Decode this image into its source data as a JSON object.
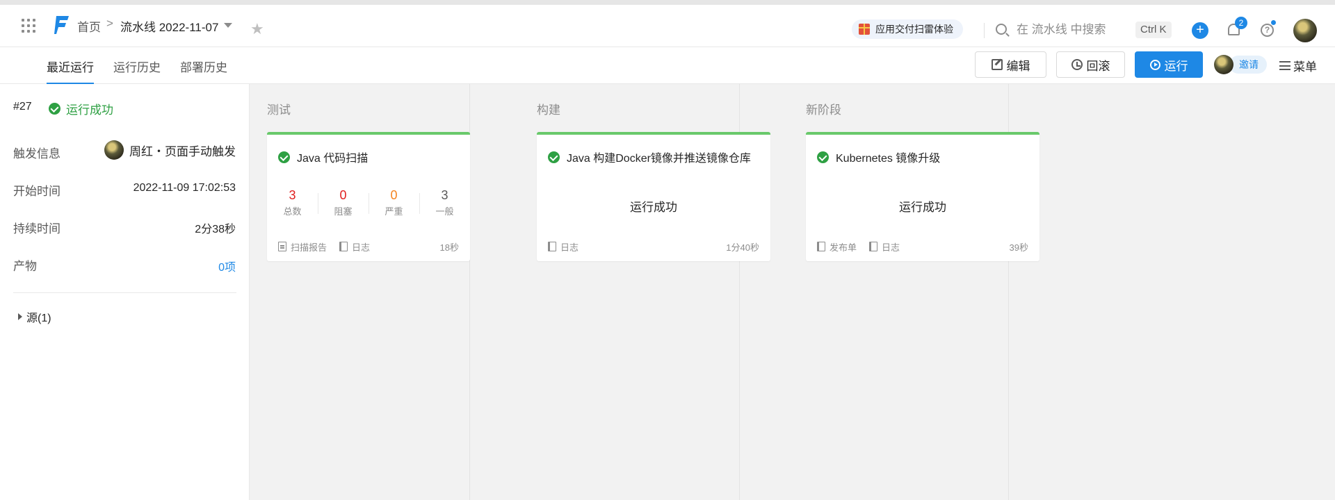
{
  "header": {
    "breadcrumb_home": "首页",
    "breadcrumb_sep": ">",
    "pipeline_name": "流水线 2022-11-07",
    "promo_label": "应用交付扫雷体验",
    "search_placeholder": "在 流水线 中搜索",
    "search_shortcut": "Ctrl K",
    "add_label": "+",
    "notification_count": "2",
    "help_label": "?"
  },
  "subnav": {
    "tabs": [
      {
        "label": "最近运行",
        "active": true
      },
      {
        "label": "运行历史",
        "active": false
      },
      {
        "label": "部署历史",
        "active": false
      }
    ],
    "edit_label": "编辑",
    "rollback_label": "回滚",
    "run_label": "运行",
    "invite_label": "邀请",
    "menu_label": "菜单"
  },
  "run": {
    "number": "#27",
    "status": "运行成功",
    "trigger_label": "触发信息",
    "trigger_value": "周红・页面手动触发",
    "start_label": "开始时间",
    "start_value": "2022-11-09 17:02:53",
    "duration_label": "持续时间",
    "duration_value": "2分38秒",
    "artifact_label": "产物",
    "artifact_value": "0项",
    "source_label": "源(1)"
  },
  "stages": [
    {
      "title": "测试",
      "job": {
        "name": "Java 代码扫描",
        "metrics": [
          {
            "value": "3",
            "label": "总数",
            "color": "#e02020"
          },
          {
            "value": "0",
            "label": "阻塞",
            "color": "#e02020"
          },
          {
            "value": "0",
            "label": "严重",
            "color": "#f5831f"
          },
          {
            "value": "3",
            "label": "一般",
            "color": "#595959"
          }
        ],
        "links": [
          "扫描报告",
          "日志"
        ],
        "duration": "18秒"
      }
    },
    {
      "title": "构建",
      "job": {
        "name": "Java 构建Docker镜像并推送镜像仓库",
        "status": "运行成功",
        "links": [
          "日志"
        ],
        "duration": "1分40秒"
      }
    },
    {
      "title": "新阶段",
      "job": {
        "name": "Kubernetes 镜像升级",
        "status": "运行成功",
        "links": [
          "发布单",
          "日志"
        ],
        "duration": "39秒"
      }
    }
  ],
  "colors": {
    "accent": "#1e88e5",
    "success": "#2ea043",
    "success_bar": "#69c96b"
  }
}
